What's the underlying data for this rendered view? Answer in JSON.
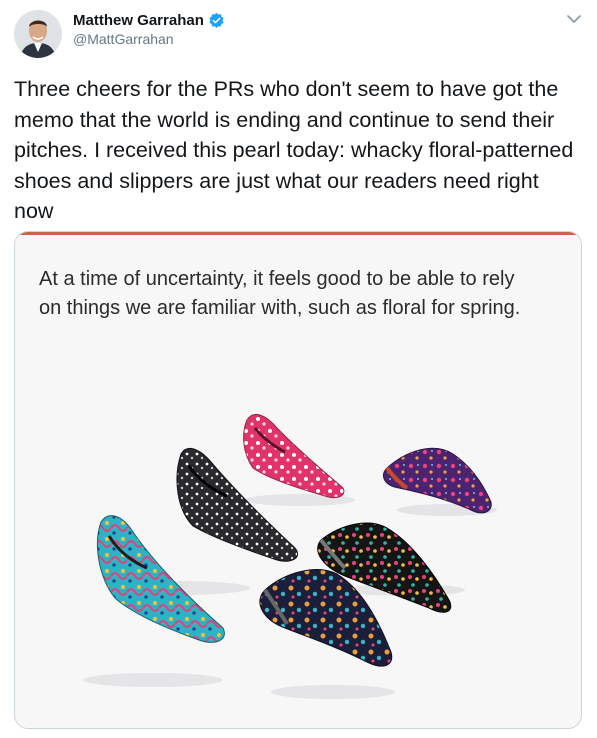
{
  "author": {
    "display_name": "Matthew Garrahan",
    "handle": "@MattGarrahan",
    "verified": true
  },
  "icons": {
    "verified": "verified-badge-icon",
    "menu": "chevron-down-icon"
  },
  "tweet": {
    "text": "Three cheers for the PRs who don't seem to have got the memo that the world is ending and continue to send their pitches. I received this pearl today: whacky floral-patterned shoes and slippers are just what our readers need right now"
  },
  "media": {
    "caption": "At a time of uncertainty, it feels good to be able to rely on things we are familiar with, such as floral for spring."
  },
  "colors": {
    "verified_blue": "#1da1f2",
    "text": "#14171a",
    "secondary": "#657786",
    "card_border": "#ccd6dd"
  }
}
